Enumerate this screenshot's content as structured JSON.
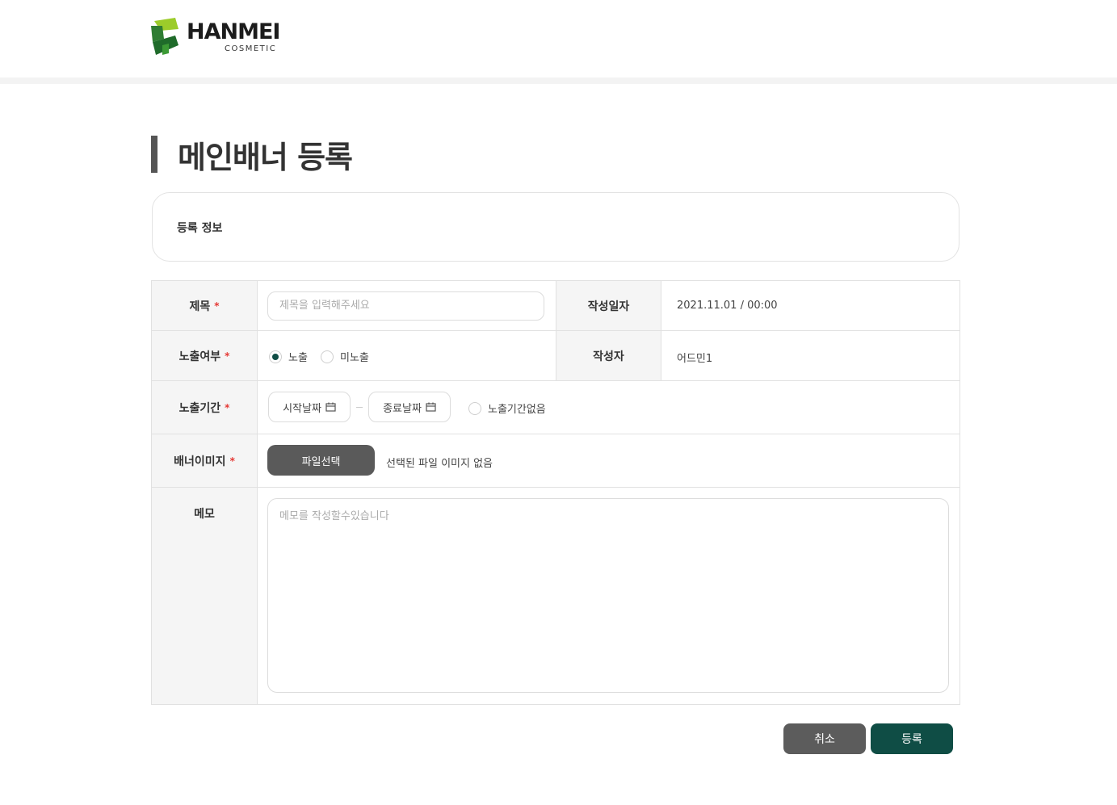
{
  "brand": {
    "name": "HANMEI",
    "sub": "COSMETIC"
  },
  "page": {
    "title": "메인배너 등록"
  },
  "section": {
    "title": "등록 정보"
  },
  "form": {
    "title_label": "제목",
    "title_placeholder": "제목을 입력해주세요",
    "created_label": "작성일자",
    "created_value": "2021.11.01 / 00:00",
    "exposure_label": "노출여부",
    "exposure_options": [
      "노출",
      "미노출"
    ],
    "exposure_selected": "노출",
    "author_label": "작성자",
    "author_value": "어드민1",
    "period_label": "노출기간",
    "start_date": "시작날짜",
    "end_date": "종료날짜",
    "no_period": "노출기간없음",
    "banner_label": "배너이미지",
    "file_button": "파일선택",
    "file_status": "선택된 파일 이미지 없음",
    "memo_label": "메모",
    "memo_placeholder": "메모를 작성할수있습니다",
    "required_mark": "*"
  },
  "actions": {
    "cancel": "취소",
    "submit": "등록"
  },
  "colors": {
    "accent": "#0f4d45",
    "neutral_button": "#5c5c5c",
    "required": "#e53935",
    "logo_green": "#4a9a2f",
    "logo_lime": "#9ccc2a"
  }
}
